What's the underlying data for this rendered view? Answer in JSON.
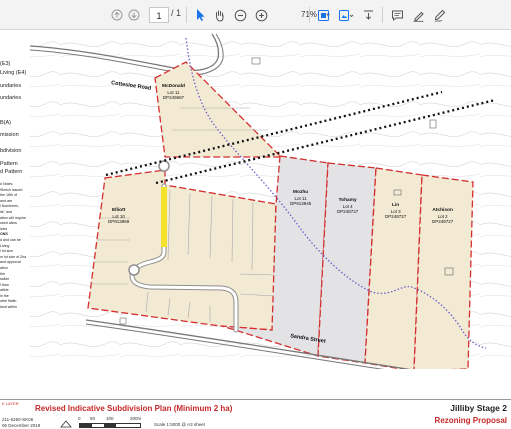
{
  "toolbar": {
    "page_current": "1",
    "page_total": "/ 1",
    "zoom_level": "71%"
  },
  "legend": {
    "items": [
      "(E3)",
      "Living (E4)",
      "undaries",
      "undaries",
      "B(A)",
      "mission",
      "bdivision",
      "Pattern",
      "d Pattern"
    ],
    "notes": [
      "d Notes",
      "Sketch issued",
      "the 16th of",
      "and are",
      "l Nominees,",
      "its\" and",
      "ation will require",
      "osed allow",
      "icies",
      "ONS",
      "d and can be",
      "Living",
      "l lot size",
      "m lot size of 2ha",
      "and approval",
      "ation",
      "the",
      "ssible",
      "l than",
      "atible",
      "in the",
      "uthe flatlin",
      "land within"
    ]
  },
  "map": {
    "road_north": "Cottesloe Road",
    "road_south": "Sandra Street",
    "lots": [
      {
        "owner": "McDonald",
        "lot": "Lot 11",
        "dp": "DP249697"
      },
      {
        "owner": "Elliott",
        "lot": "Lot 10",
        "dp": "DP913969"
      },
      {
        "owner": "Mozhu",
        "lot": "Lot 11",
        "dp": "DP913945"
      },
      {
        "owner": "Tohamy",
        "lot": "Lot 4",
        "dp": "DP248727"
      },
      {
        "owner": "Lin",
        "lot": "Lot 3",
        "dp": "DP248727"
      },
      {
        "owner": "Atchison",
        "lot": "Lot 2",
        "dp": "DP248727"
      }
    ]
  },
  "title_block": {
    "red_note": "K LAYER",
    "title": "Revised Indicative Subdivision Plan (Minimum 2 ha)",
    "project": "Jilliby Stage 2",
    "subtitle": "Rezoning Proposal",
    "drawing_no": "211-5250-SK06",
    "date": "06 December 2019",
    "scale_bar_labels": [
      "0",
      "50",
      "100",
      "200m"
    ],
    "scale_text": "Scale 1:5000 @ A3 sheet"
  },
  "colors": {
    "accent_red": "#c62828",
    "lot_fill": "#f3ead4",
    "grey_lot": "#e3e3e6",
    "toolbar_icon_blue": "#1a73e8"
  }
}
